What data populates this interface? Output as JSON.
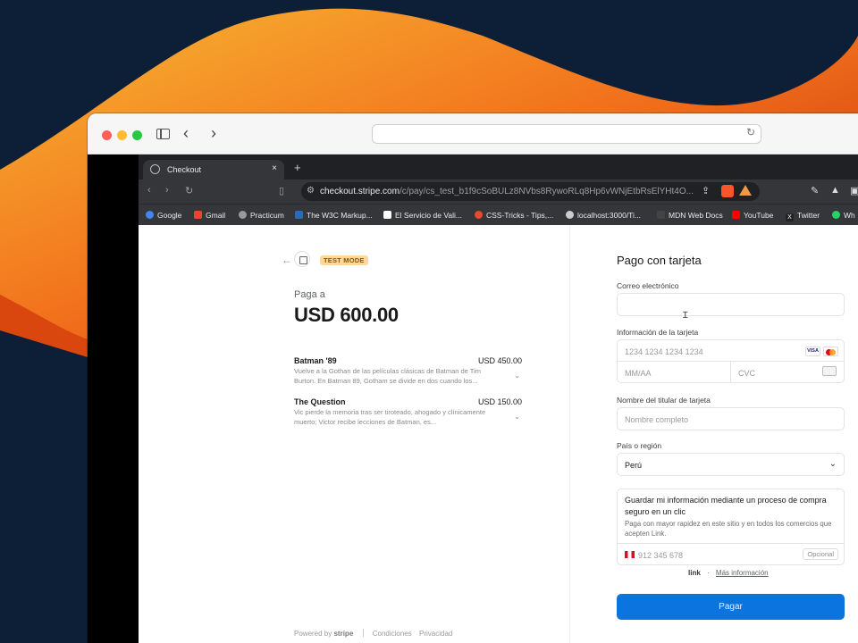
{
  "browser_tab": {
    "title": "Checkout",
    "close": "×",
    "new_tab": "+"
  },
  "address": {
    "host": "checkout.stripe.com",
    "path": "/c/pay/cs_test_b1f9cSoBULz8NVbs8RywoRLq8Hp6vWNjEtbRsElYHt4O..."
  },
  "bookmarks": [
    "Google",
    "Gmail",
    "Practicum",
    "The W3C Markup...",
    "El Servicio de Vali...",
    "CSS-Tricks - Tips,...",
    "localhost:3000/Ti...",
    "MDN Web Docs",
    "YouTube",
    "Twitter",
    "Wh"
  ],
  "order": {
    "test_mode": "TEST MODE",
    "pay_to": "Paga a",
    "total": "USD 600.00",
    "items": [
      {
        "name": "Batman '89",
        "price": "USD 450.00",
        "desc": "Vuelve a la Gothan de las películas clásicas de Batman de Tim Burton. En Batman 89, Gotham se divide en dos cuando los..."
      },
      {
        "name": "The Question",
        "price": "USD 150.00",
        "desc": "Vic pierde la memoria tras ser tiroteado, ahogado y clínicamente muerto; Victor recibe lecciones de Batman, es..."
      }
    ],
    "footer": {
      "powered": "Powered by",
      "brand": "stripe",
      "terms": "Condiciones",
      "privacy": "Privacidad"
    }
  },
  "form": {
    "heading": "Pago con tarjeta",
    "email_label": "Correo electrónico",
    "card_label": "Información de la tarjeta",
    "card_number_ph": "1234 1234 1234 1234",
    "expiry_ph": "MM/AA",
    "cvc_ph": "CVC",
    "visa": "VISA",
    "name_label": "Nombre del titular de tarjeta",
    "name_ph": "Nombre completo",
    "country_label": "País o región",
    "country_value": "Perú",
    "link_title": "Guardar mi información mediante un proceso de compra seguro en un clic",
    "link_desc": "Paga con mayor rapidez en este sitio y en todos los comercios que acepten Link.",
    "phone_ph": "912 345 678",
    "optional": "Opcional",
    "link_brand": "link",
    "more_info": "Más información",
    "pay_button": "Pagar"
  },
  "colors": {
    "accent": "#0b74de",
    "testmode_bg": "#ffd79b"
  }
}
